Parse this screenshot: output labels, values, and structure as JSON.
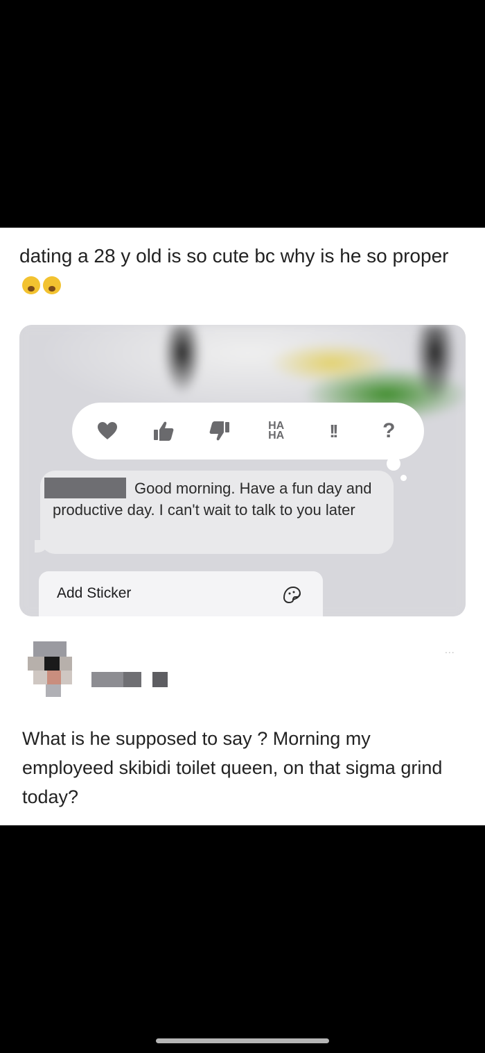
{
  "post": {
    "caption": "dating a 28 y old is so cute bc why is he so proper",
    "caption_emojis": [
      "crying-face-emoji",
      "crying-face-emoji"
    ]
  },
  "message_screenshot": {
    "reactions": [
      {
        "name": "heart-icon"
      },
      {
        "name": "thumbs-up-icon"
      },
      {
        "name": "thumbs-down-icon"
      },
      {
        "name": "haha-icon",
        "label": "HA\nHA"
      },
      {
        "name": "exclamation-icon",
        "label": "!!"
      },
      {
        "name": "question-icon",
        "label": "?"
      }
    ],
    "message_text": "Good morning. Have a fun day and productive day. I can't wait to talk to you later",
    "add_sticker_label": "Add Sticker",
    "sticker_icon": "sticker-icon"
  },
  "reply": {
    "more_label": "...",
    "text": "What is he supposed to say ? Morning my employeed skibidi toilet queen, on that sigma grind today?"
  },
  "colors": {
    "page_background": "#000000",
    "card_background": "#ffffff",
    "bubble_gray": "#e9e9eb",
    "icon_gray": "#6a6a6d"
  }
}
